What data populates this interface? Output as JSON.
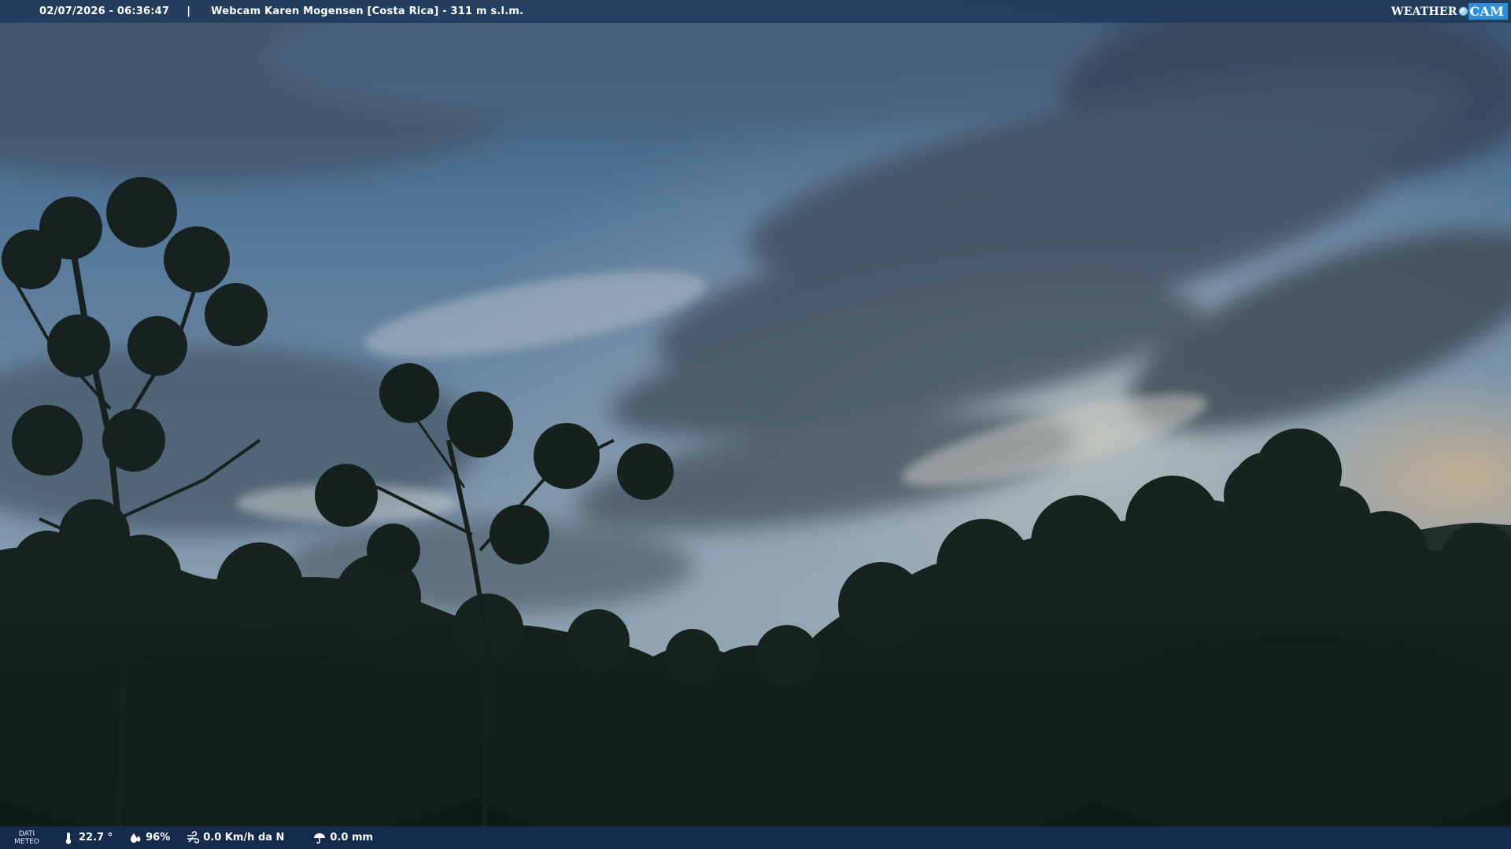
{
  "header": {
    "datetime": "02/07/2026 - 06:36:47",
    "separator": "|",
    "title": "Webcam Karen Mogensen [Costa Rica]  - 311 m s.l.m."
  },
  "logo": {
    "part1": "Weather",
    "part2": "Cam"
  },
  "meteo": {
    "label_line1": "DATI",
    "label_line2": "METEO",
    "temperature": "22.7 °",
    "humidity": "96%",
    "wind": "0.0 Km/h da N",
    "rain": "0.0 mm"
  },
  "icons": {
    "temperature": "thermometer-icon",
    "humidity": "humidity-drop-icon",
    "wind": "wind-icon",
    "rain": "umbrella-icon",
    "logo_dot": "weather-globe-icon"
  },
  "colors": {
    "bar": "#203a5c",
    "logo_accent": "#2f8fd8"
  }
}
